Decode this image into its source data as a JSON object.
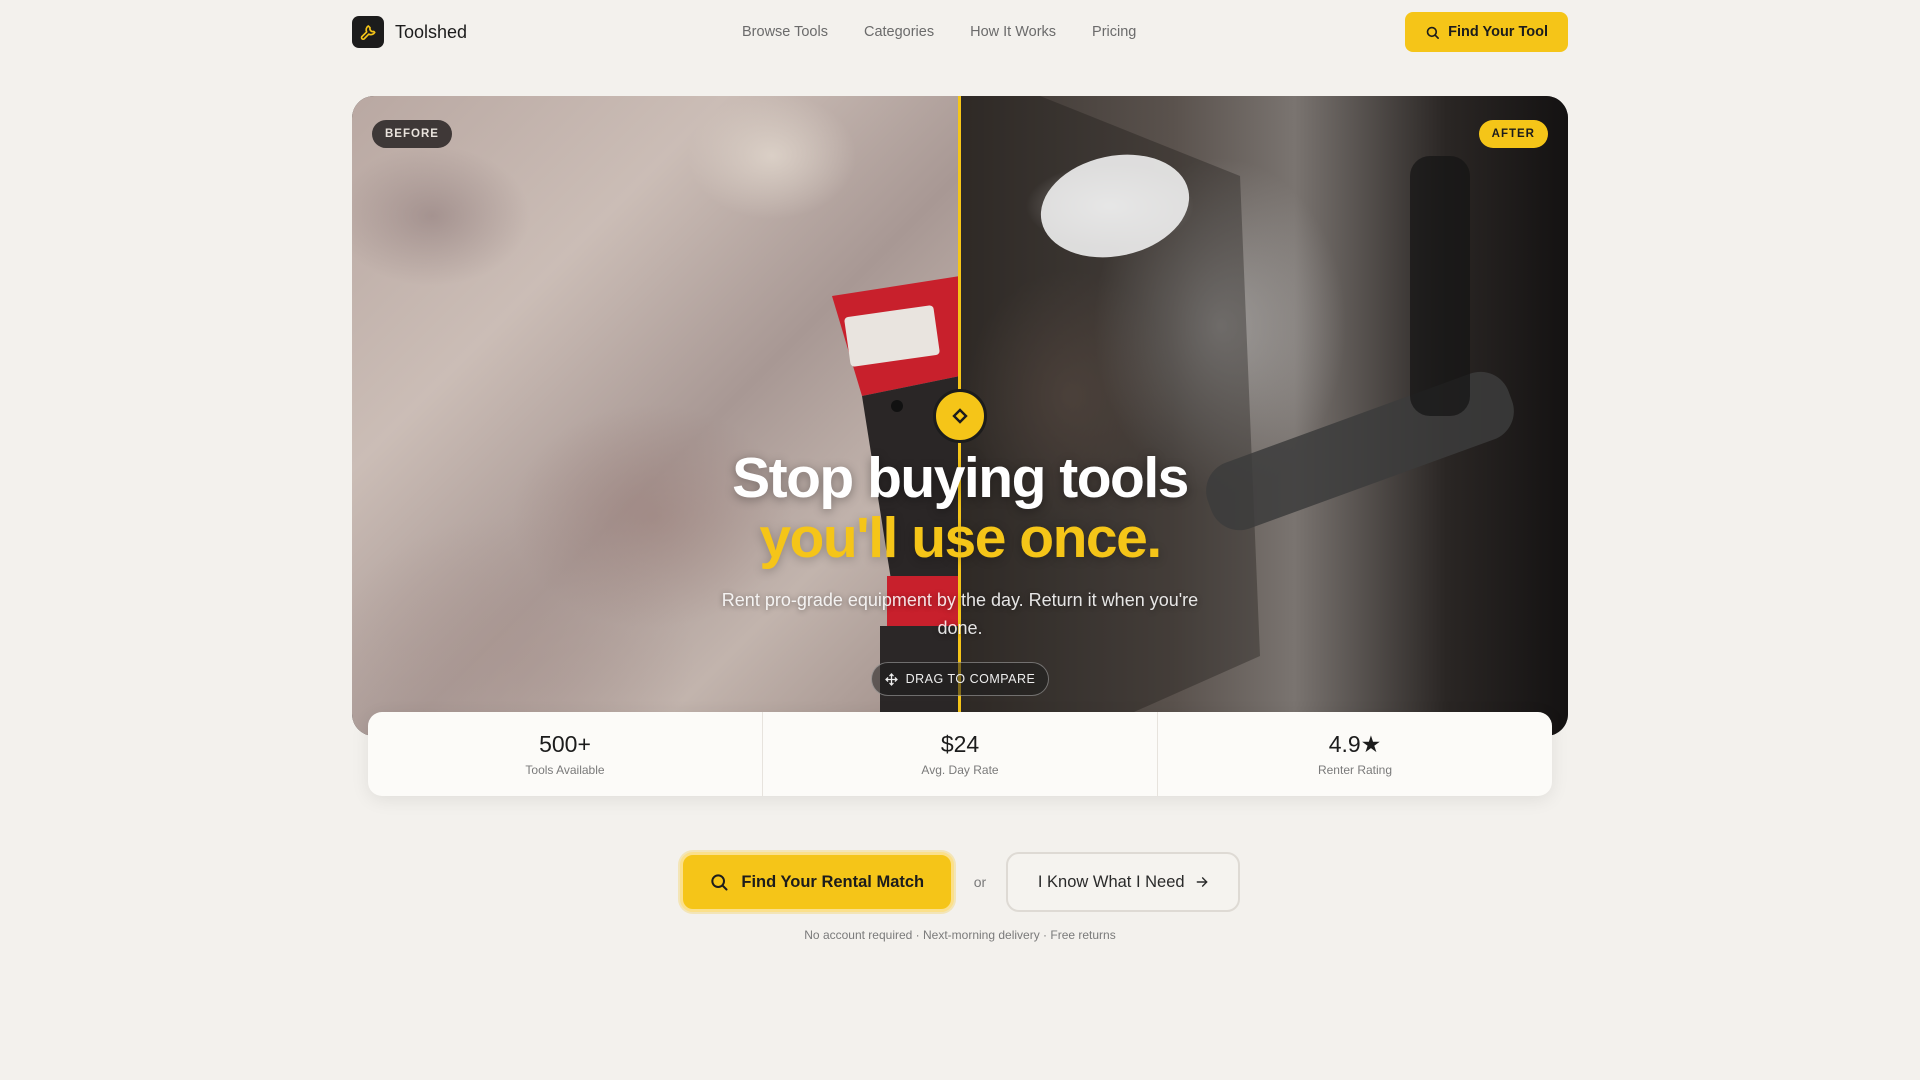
{
  "nav": {
    "brand": "Toolshed",
    "links": [
      "Browse Tools",
      "Categories",
      "How It Works",
      "Pricing"
    ],
    "cta_label": "Find Your Tool"
  },
  "hero": {
    "before_tag": "BEFORE",
    "after_tag": "AFTER",
    "headline_line1": "Stop buying tools",
    "headline_line2": "you'll use once.",
    "subtitle": "Rent pro-grade equipment by the day. Return it when you're done.",
    "drag_hint": "DRAG TO COMPARE"
  },
  "stats": [
    {
      "value": "500+",
      "label": "Tools Available"
    },
    {
      "value": "$24",
      "label": "Avg. Day Rate"
    },
    {
      "value": "4.9★",
      "label": "Renter Rating"
    }
  ],
  "cta": {
    "primary_label": "Find Your Rental Match",
    "or_text": "or",
    "secondary_label": "I Know What I Need",
    "fineprint": "No account required · Next-morning delivery · Free returns"
  },
  "colors": {
    "accent": "#f5c518",
    "background": "#f3f1ed",
    "text": "#1c1c1c"
  },
  "icons": [
    "wrench-icon",
    "search-icon",
    "diamond-handle-icon",
    "move-icon",
    "arrow-right-icon"
  ]
}
